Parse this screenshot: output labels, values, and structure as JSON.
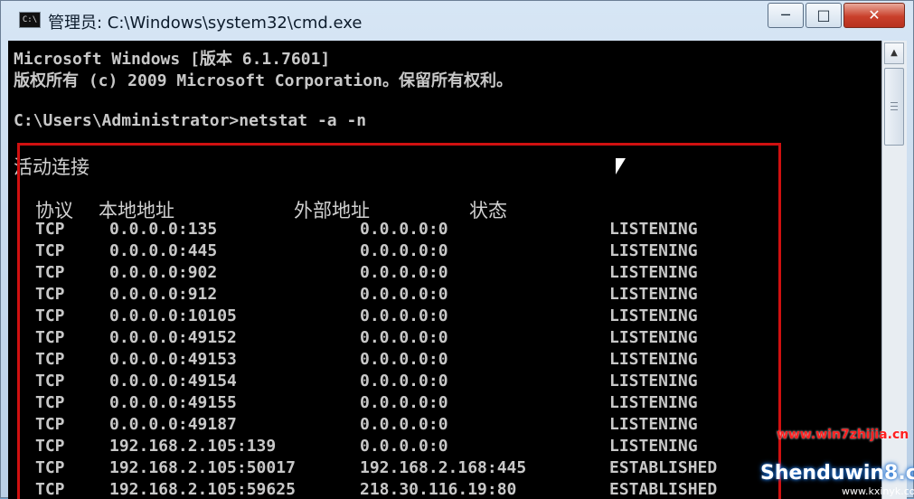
{
  "window": {
    "title": "管理员: C:\\Windows\\system32\\cmd.exe",
    "icon_label": "C:\\",
    "buttons": {
      "minimize": "─",
      "maximize": "□",
      "close": "✕"
    }
  },
  "console": {
    "line1": "Microsoft Windows [版本 6.1.7601]",
    "line2": "版权所有 (c) 2009 Microsoft Corporation。保留所有权利。",
    "prompt_line": "C:\\Users\\Administrator>netstat -a -n",
    "section_title": "活动连接",
    "headers": {
      "proto": "协议",
      "local": "本地地址",
      "foreign": "外部地址",
      "state": "状态"
    },
    "rows": [
      {
        "proto": "TCP",
        "local": "0.0.0.0:135",
        "foreign": "0.0.0.0:0",
        "state": "LISTENING"
      },
      {
        "proto": "TCP",
        "local": "0.0.0.0:445",
        "foreign": "0.0.0.0:0",
        "state": "LISTENING"
      },
      {
        "proto": "TCP",
        "local": "0.0.0.0:902",
        "foreign": "0.0.0.0:0",
        "state": "LISTENING"
      },
      {
        "proto": "TCP",
        "local": "0.0.0.0:912",
        "foreign": "0.0.0.0:0",
        "state": "LISTENING"
      },
      {
        "proto": "TCP",
        "local": "0.0.0.0:10105",
        "foreign": "0.0.0.0:0",
        "state": "LISTENING"
      },
      {
        "proto": "TCP",
        "local": "0.0.0.0:49152",
        "foreign": "0.0.0.0:0",
        "state": "LISTENING"
      },
      {
        "proto": "TCP",
        "local": "0.0.0.0:49153",
        "foreign": "0.0.0.0:0",
        "state": "LISTENING"
      },
      {
        "proto": "TCP",
        "local": "0.0.0.0:49154",
        "foreign": "0.0.0.0:0",
        "state": "LISTENING"
      },
      {
        "proto": "TCP",
        "local": "0.0.0.0:49155",
        "foreign": "0.0.0.0:0",
        "state": "LISTENING"
      },
      {
        "proto": "TCP",
        "local": "0.0.0.0:49187",
        "foreign": "0.0.0.0:0",
        "state": "LISTENING"
      },
      {
        "proto": "TCP",
        "local": "192.168.2.105:139",
        "foreign": "0.0.0.0:0",
        "state": "LISTENING"
      },
      {
        "proto": "TCP",
        "local": "192.168.2.105:50017",
        "foreign": "192.168.2.168:445",
        "state": "ESTABLISHED"
      },
      {
        "proto": "TCP",
        "local": "192.168.2.105:59625",
        "foreign": "218.30.116.19:80",
        "state": "ESTABLISHED"
      }
    ]
  },
  "scrollbar": {
    "up_arrow": "▲"
  },
  "watermarks": {
    "site1": "www.win7zhijia.cn",
    "site2": "Shenduwin8.com",
    "site3": "www.kxinyk.com"
  },
  "colors": {
    "console_bg": "#000000",
    "console_text": "#c8c8c8",
    "highlight": "#d01010"
  }
}
